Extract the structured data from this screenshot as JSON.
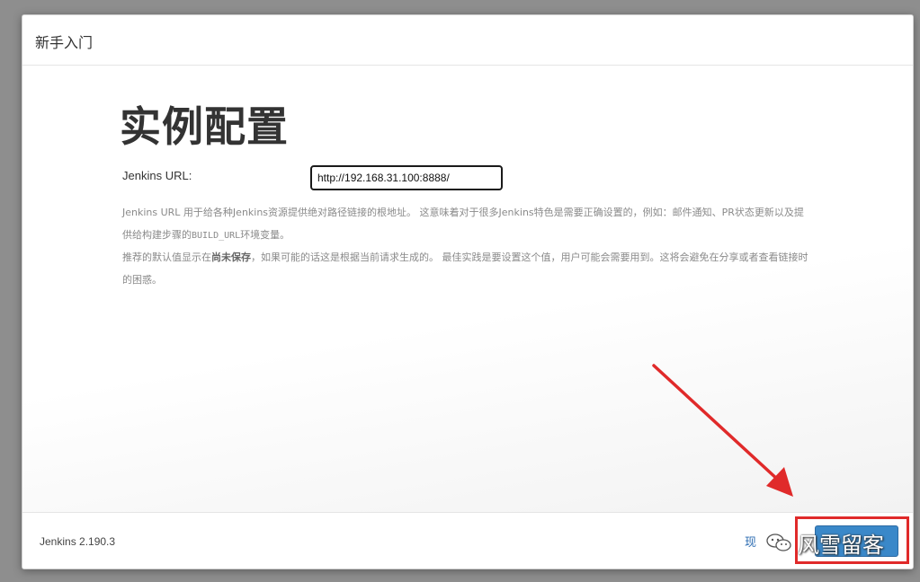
{
  "dialog": {
    "title": "新手入门",
    "heading": "实例配置",
    "url_field": {
      "label": "Jenkins URL:",
      "value": "http://192.168.31.100:8888/"
    },
    "help": {
      "p1": "Jenkins URL 用于给各种Jenkins资源提供绝对路径链接的根地址。 这意味着对于很多Jenkins特色是需要正确设置的，例如：邮件通知、PR状态更新以及提供给构建步骤的",
      "p1_code": "BUILD_URL",
      "p1_tail": "环境变量。",
      "p2_pre": "推荐的默认值显示在",
      "p2_strong": "尚未保存",
      "p2_post": "，如果可能的话这是根据当前请求生成的。 最佳实践是要设置这个值，用户可能会需要用到。这将会避免在分享或者查看链接时的困惑。"
    }
  },
  "footer": {
    "version": "Jenkins 2.190.3",
    "skip_label": "现",
    "save_label": "",
    "watermark_text": "风雪留客"
  },
  "colors": {
    "backdrop": "#8e8e8e",
    "primary_button": "#3a88c9",
    "link": "#2b6bb1",
    "annotation_red": "#e02a2a"
  },
  "icons": {
    "watermark": "wechat-icon"
  }
}
